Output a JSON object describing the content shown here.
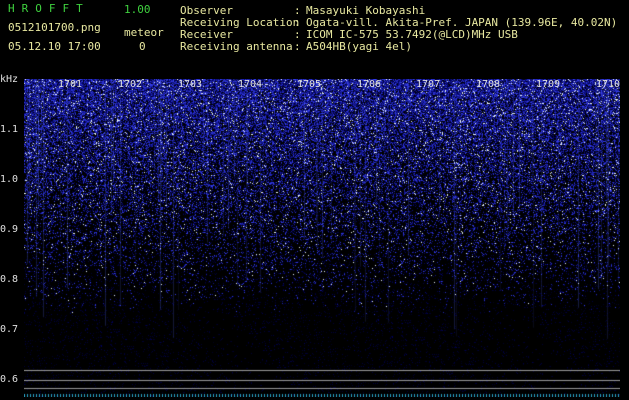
{
  "app": {
    "name": "HROFFT",
    "version": "1.00"
  },
  "file": {
    "name": "0512101700.png",
    "datetime": "05.12.10 17:00"
  },
  "meteor": {
    "label": "meteor",
    "count": "0"
  },
  "info": [
    {
      "key": "Observer",
      "sep": ":",
      "value": "Masayuki Kobayashi"
    },
    {
      "key": "Receiving Location",
      "sep": ":",
      "value": "Ogata-vill. Akita-Pref. JAPAN (139.96E, 40.02N)"
    },
    {
      "key": "Receiver",
      "sep": ":",
      "value": "ICOM IC-575 53.7492(@LCD)MHz USB"
    },
    {
      "key": "Receiving antenna",
      "sep": ":",
      "value": "A504HB(yagi 4el)"
    }
  ],
  "axes": {
    "y_unit": "kHz",
    "y_ticks": [
      "1.1",
      "1.0",
      "0.9",
      "0.8",
      "0.7",
      "0.6"
    ],
    "x_ticks": [
      "1701",
      "1702",
      "1703",
      "1704",
      "1705",
      "1706",
      "1707",
      "1708",
      "1709",
      "1710"
    ]
  },
  "colors": {
    "background": "#000000",
    "signal": "#2a3cff",
    "text_green": "#3fd13f",
    "text_yellow": "#e8e8a0"
  }
}
